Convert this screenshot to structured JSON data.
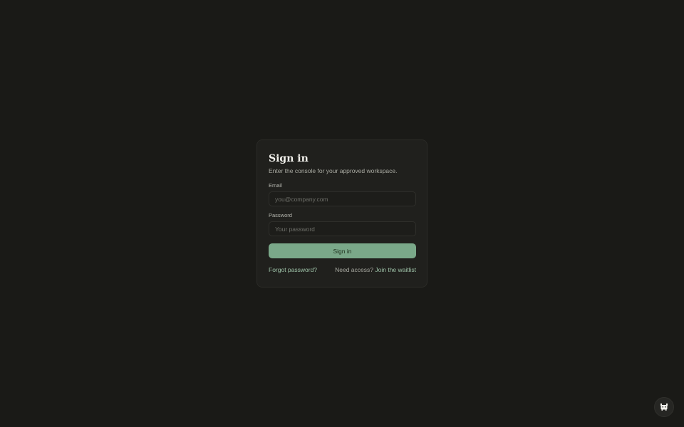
{
  "signin": {
    "title": "Sign in",
    "subtitle": "Enter the console for your approved workspace.",
    "email": {
      "label": "Email",
      "value": "",
      "placeholder": "you@company.com"
    },
    "password": {
      "label": "Password",
      "value": "",
      "placeholder": "Your password"
    },
    "submit_label": "Sign in",
    "forgot_link": "Forgot password?",
    "access_prompt": "Need access?",
    "waitlist_link": "Join the waitlist"
  },
  "floating_button": {
    "icon": "bot-icon"
  },
  "colors": {
    "background": "#1a1a17",
    "card": "#20201d",
    "accent": "#7aa889",
    "link": "#9fc4a9"
  }
}
